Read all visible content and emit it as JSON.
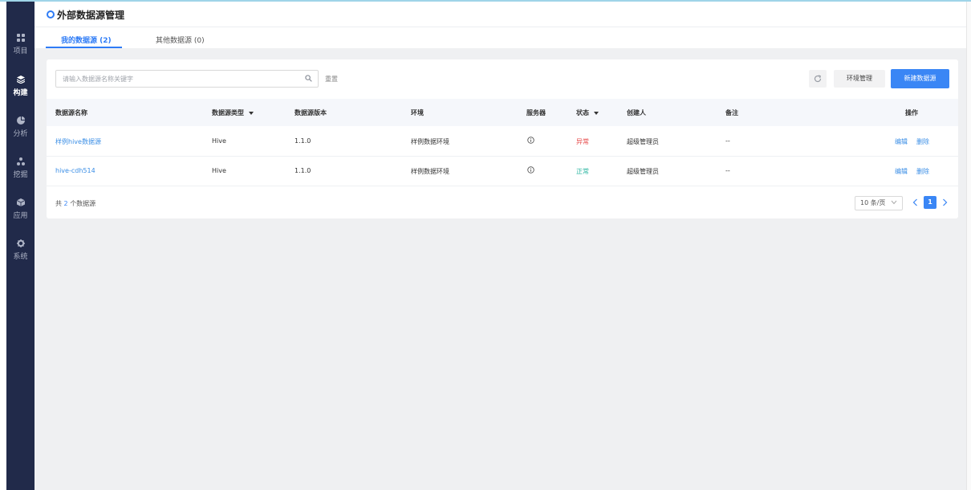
{
  "sidebar": {
    "items": [
      {
        "label": "项目",
        "icon": "grid-icon"
      },
      {
        "label": "构建",
        "icon": "layers-icon",
        "active": true
      },
      {
        "label": "分析",
        "icon": "pie-chart-icon"
      },
      {
        "label": "挖掘",
        "icon": "nodes-icon"
      },
      {
        "label": "应用",
        "icon": "cube-icon"
      },
      {
        "label": "系统",
        "icon": "gear-icon"
      }
    ]
  },
  "header": {
    "title": "外部数据源管理"
  },
  "tabs": [
    {
      "label": "我的数据源 (2)",
      "active": true
    },
    {
      "label": "其他数据源 (0)",
      "active": false
    }
  ],
  "toolbar": {
    "search_placeholder": "请输入数据源名称关键字",
    "search_value": "",
    "reset_label": "重置",
    "env_label": "环境管理",
    "new_label": "新建数据源"
  },
  "table": {
    "columns": [
      "数据源名称",
      "数据源类型",
      "数据源版本",
      "环境",
      "服务器",
      "状态",
      "创建人",
      "备注",
      "操作"
    ],
    "rows": [
      {
        "name": "样例hive数据源",
        "type": "Hive",
        "version": "1.1.0",
        "env": "样例数据环境",
        "status": "异常",
        "creator": "超级管理员",
        "note": "--",
        "edit": "编辑",
        "delete": "删除"
      },
      {
        "name": "hive-cdh514",
        "type": "Hive",
        "version": "1.1.0",
        "env": "样例数据环境",
        "status": "正常",
        "creator": "超级管理员",
        "note": "--",
        "edit": "编辑",
        "delete": "删除"
      }
    ]
  },
  "footer": {
    "total_prefix": "共",
    "total_count": "2",
    "total_suffix": "个数据源",
    "page_size": "10 条/页",
    "current_page": "1"
  },
  "colors": {
    "accent": "#3a86f5",
    "sidebar": "#212a4a",
    "abnormal": "#e64545",
    "normal": "#2bb5a0",
    "link": "#3a8ee6"
  }
}
